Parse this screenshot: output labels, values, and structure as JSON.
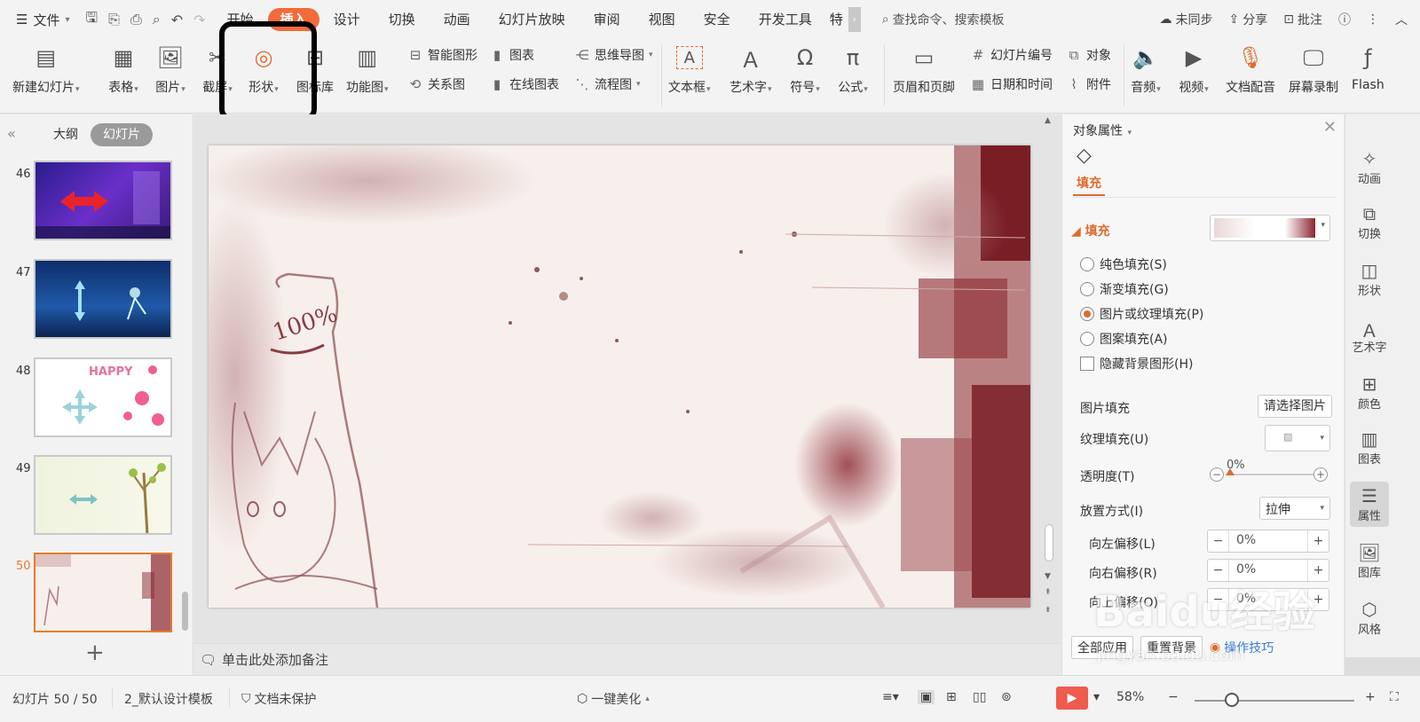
{
  "menubar": {
    "file_label": "文件",
    "tabs": [
      "开始",
      "插入",
      "设计",
      "切换",
      "动画",
      "幻灯片放映",
      "审阅",
      "视图",
      "安全",
      "开发工具",
      "特"
    ],
    "active_tab": "插入",
    "search_label": "查找命令、搜索模板",
    "sync_label": "未同步",
    "share_label": "分享",
    "comment_label": "批注"
  },
  "ribbon": {
    "new_slide": "新建幻灯片",
    "table": "表格",
    "picture": "图片",
    "screenshot": "截屏",
    "shape": "形状",
    "icon_lib": "图标库",
    "function_chart": "功能图",
    "smart_art": "智能图形",
    "chart": "图表",
    "mindmap": "思维导图",
    "relation": "关系图",
    "online_chart": "在线图表",
    "flowchart": "流程图",
    "textbox": "文本框",
    "wordart": "艺术字",
    "symbol": "符号",
    "formula": "公式",
    "header_footer": "页眉和页脚",
    "slide_number": "幻灯片编号",
    "object": "对象",
    "datetime": "日期和时间",
    "attachment": "附件",
    "audio": "音频",
    "video": "视频",
    "voiceover": "文档配音",
    "screen_record": "屏幕录制",
    "flash": "Flash"
  },
  "leftpanel": {
    "tab_outline": "大纲",
    "tab_slides": "幻灯片",
    "slides": [
      {
        "num": "46"
      },
      {
        "num": "47"
      },
      {
        "num": "48",
        "text": "HAPPY"
      },
      {
        "num": "49"
      },
      {
        "num": "50"
      }
    ],
    "add_label": "+"
  },
  "main": {
    "notes_placeholder": "单击此处添加备注",
    "slide_text": "100%"
  },
  "props": {
    "title": "对象属性",
    "tab_fill": "填充",
    "section_fill": "填充",
    "options": [
      {
        "label": "纯色填充(S)",
        "selected": false
      },
      {
        "label": "渐变填充(G)",
        "selected": false
      },
      {
        "label": "图片或纹理填充(P)",
        "selected": true
      },
      {
        "label": "图案填充(A)",
        "selected": false
      }
    ],
    "hide_bg_graphics": "隐藏背景图形(H)",
    "picture_fill_label": "图片填充",
    "picture_fill_btn": "请选择图片",
    "texture_fill_label": "纹理填充(U)",
    "transparency_label": "透明度(T)",
    "transparency_value": "0%",
    "placement_label": "放置方式(I)",
    "placement_value": "拉伸",
    "offset_left_label": "向左偏移(L)",
    "offset_left_value": "0%",
    "offset_right_label": "向右偏移(R)",
    "offset_right_value": "0%",
    "offset_up_label": "向上偏移(O)",
    "offset_up_value": "0%",
    "apply_all": "全部应用",
    "reset_bg": "重置背景",
    "tips": "操作技巧"
  },
  "rightbar": {
    "items": [
      "动画",
      "切换",
      "形状",
      "艺术字",
      "颜色",
      "图表",
      "属性",
      "图库",
      "风格"
    ],
    "active": "属性"
  },
  "statusbar": {
    "slide_counter": "幻灯片 50 / 50",
    "template": "2_默认设计模板",
    "protect": "文档未保护",
    "beautify": "一键美化",
    "zoom": "58%"
  },
  "watermark": {
    "text": "Baidu经验",
    "url": "jingyan.baidu.com"
  },
  "colors": {
    "accent": "#f26b3a",
    "slide_bg": "#f7efec",
    "stain": "#8a2830"
  }
}
